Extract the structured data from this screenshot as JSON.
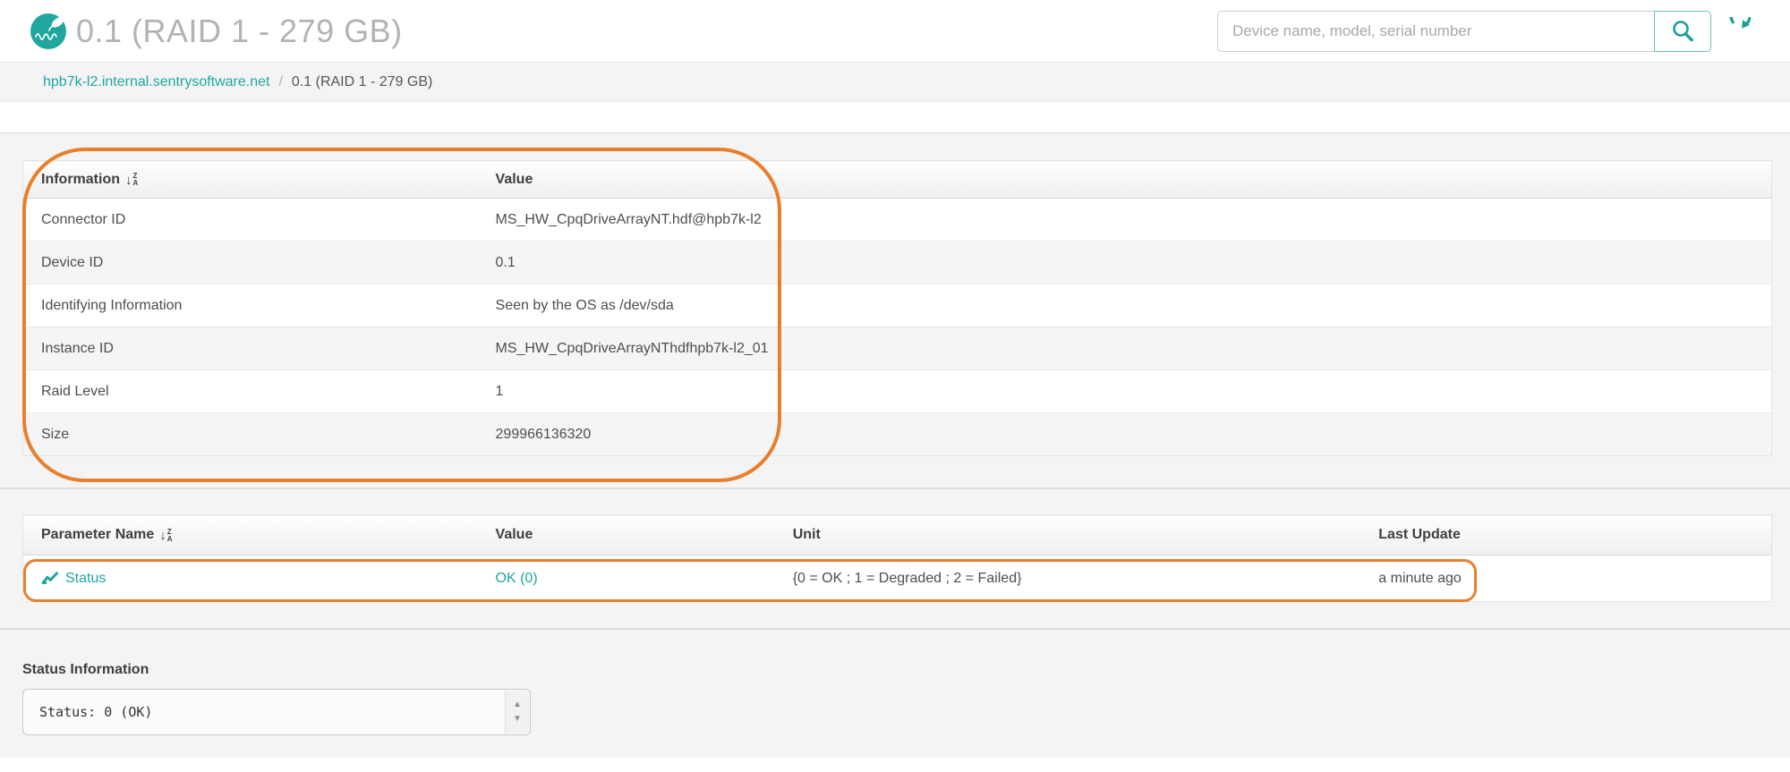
{
  "colors": {
    "brand_teal": "#1fa79e",
    "annotation_orange": "#e87f2c"
  },
  "header": {
    "title": "0.1 (RAID 1 - 279 GB)",
    "search_placeholder": "Device name, model, serial number"
  },
  "breadcrumb": {
    "host": "hpb7k-l2.internal.sentrysoftware.net",
    "separator": "/",
    "current": "0.1 (RAID 1 - 279 GB)"
  },
  "info_table": {
    "headers": [
      "Information",
      "Value"
    ],
    "rows": [
      {
        "label": "Connector ID",
        "value": "MS_HW_CpqDriveArrayNT.hdf@hpb7k-l2"
      },
      {
        "label": "Device ID",
        "value": "0.1"
      },
      {
        "label": "Identifying Information",
        "value": "Seen by the OS as /dev/sda"
      },
      {
        "label": "Instance ID",
        "value": "MS_HW_CpqDriveArrayNThdfhpb7k-l2_01"
      },
      {
        "label": "Raid Level",
        "value": "1"
      },
      {
        "label": "Size",
        "value": "299966136320"
      }
    ]
  },
  "parameter_table": {
    "headers": [
      "Parameter Name",
      "Value",
      "Unit",
      "Last Update"
    ],
    "rows": [
      {
        "name": "Status",
        "value": "OK (0)",
        "unit": "{0 = OK ; 1 = Degraded ; 2 = Failed}",
        "last_update": "a minute ago"
      }
    ]
  },
  "status_information": {
    "label": "Status Information",
    "content": "Status: 0 (OK)"
  }
}
